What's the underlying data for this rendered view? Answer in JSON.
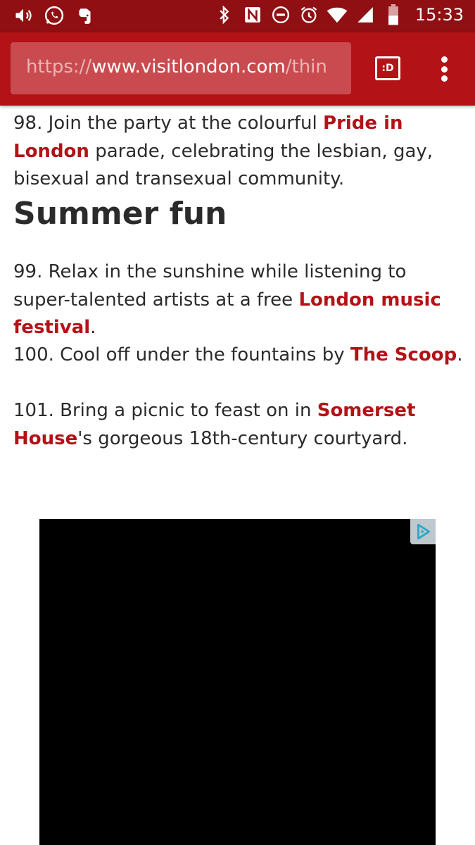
{
  "status_bar": {
    "time": "15:33",
    "left_icons": [
      "volume-icon",
      "whatsapp-icon",
      "evernote-icon"
    ],
    "right_icons": [
      "bluetooth-icon",
      "nfc-icon",
      "do-not-disturb-icon",
      "alarm-icon",
      "wifi-icon",
      "signal-icon",
      "battery-icon"
    ]
  },
  "browser": {
    "url_scheme": "https://",
    "url_host": "www.visitlondon.com",
    "url_path": "/thin",
    "reader_label": ":D"
  },
  "article": {
    "item98": {
      "prefix": "98. Join the party at the colourful ",
      "link": "Pride in London",
      "suffix": " parade, celebrating the lesbian, gay, bisexual and transexual community."
    },
    "heading": "Summer fun",
    "item99": {
      "prefix": "99. Relax in the sunshine while listening to super-talented artists at a free ",
      "link": "London music festival",
      "suffix": "."
    },
    "item100": {
      "prefix": "100. Cool off under the fountains by ",
      "link": "The Scoop",
      "suffix": "."
    },
    "item101": {
      "prefix": "101. Bring a picnic to feast on in ",
      "link": "Somerset House",
      "suffix": "'s gorgeous 18th-century courtyard."
    }
  },
  "ad": {
    "badge_icon": "adchoices-icon",
    "background": "#000000"
  },
  "colors": {
    "status_bar": "#8f0f13",
    "toolbar": "#b31217",
    "link": "#b31217",
    "text": "#2b2b2b"
  }
}
